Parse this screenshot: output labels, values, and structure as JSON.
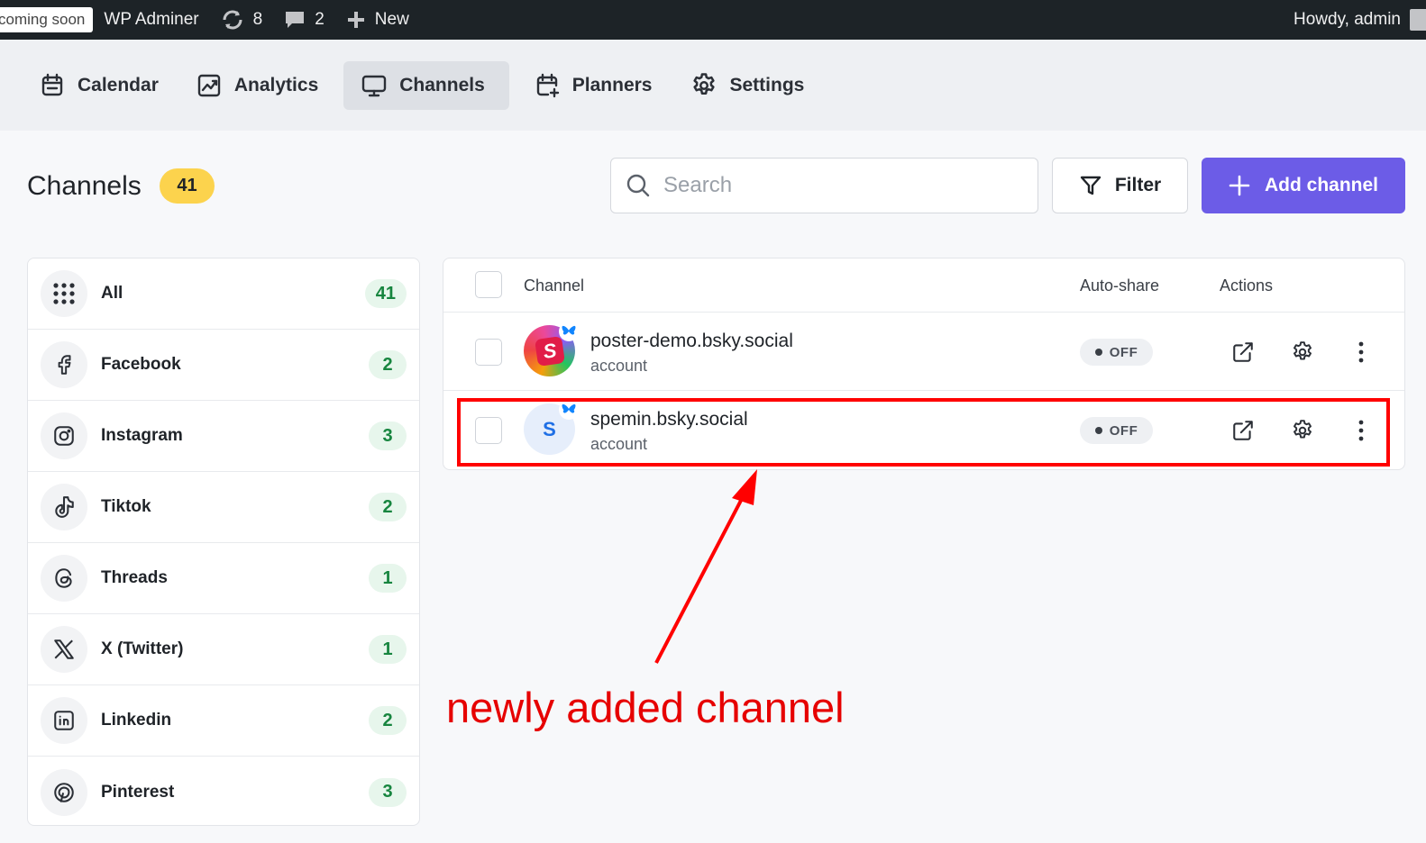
{
  "adminbar": {
    "coming_soon": "coming soon",
    "site_name": "WP Adminer",
    "updates_count": "8",
    "comments_count": "2",
    "new_label": "New",
    "greeting": "Howdy, admin"
  },
  "nav": {
    "items": [
      {
        "label": "Calendar",
        "icon": "calendar-icon",
        "active": false
      },
      {
        "label": "Analytics",
        "icon": "analytics-icon",
        "active": false
      },
      {
        "label": "Channels",
        "icon": "monitor-icon",
        "active": true
      },
      {
        "label": "Planners",
        "icon": "calendar-plus-icon",
        "active": false
      },
      {
        "label": "Settings",
        "icon": "gear-icon",
        "active": false
      }
    ]
  },
  "header": {
    "title": "Channels",
    "count": "41",
    "search_placeholder": "Search",
    "filter_label": "Filter",
    "add_label": "Add channel"
  },
  "sidebar": {
    "items": [
      {
        "label": "All",
        "count": "41",
        "icon": "grid-dots-icon"
      },
      {
        "label": "Facebook",
        "count": "2",
        "icon": "facebook-icon"
      },
      {
        "label": "Instagram",
        "count": "3",
        "icon": "instagram-icon"
      },
      {
        "label": "Tiktok",
        "count": "2",
        "icon": "tiktok-icon"
      },
      {
        "label": "Threads",
        "count": "1",
        "icon": "threads-icon"
      },
      {
        "label": "X (Twitter)",
        "count": "1",
        "icon": "x-twitter-icon"
      },
      {
        "label": "Linkedin",
        "count": "2",
        "icon": "linkedin-icon"
      },
      {
        "label": "Pinterest",
        "count": "3",
        "icon": "pinterest-icon"
      }
    ]
  },
  "table": {
    "columns": [
      "Channel",
      "Auto-share",
      "Actions"
    ],
    "rows": [
      {
        "name": "poster-demo.bsky.social",
        "type": "account",
        "auto_share": "OFF",
        "avatar_letter": "S"
      },
      {
        "name": "spemin.bsky.social",
        "type": "account",
        "auto_share": "OFF",
        "avatar_letter": "S"
      }
    ]
  },
  "annotation": {
    "text": "newly added channel",
    "color": "#ff0000"
  },
  "colors": {
    "accent": "#6c5ce7",
    "badge_yellow": "#fcd34d",
    "count_green": "#17853f",
    "adminbar": "#1d2327"
  }
}
